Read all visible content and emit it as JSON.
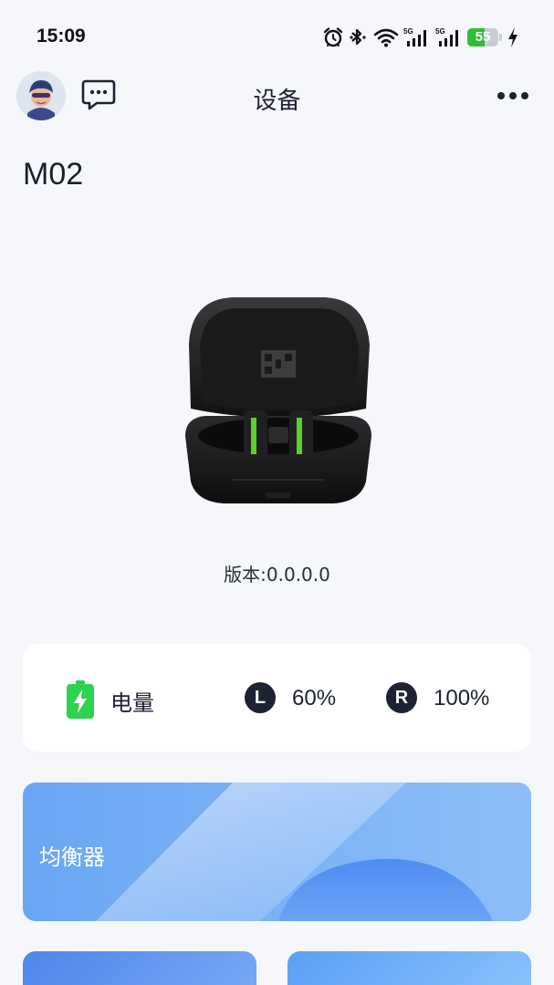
{
  "status_bar": {
    "time": "15:09",
    "icons": [
      "alarm-icon",
      "bluetooth-icon",
      "wifi-icon",
      "signal-5g-icon",
      "signal-5g-icon",
      "battery-icon",
      "charging-icon"
    ],
    "network_1": "5G",
    "network_2": "5G",
    "battery_percent": "55",
    "battery_color": "#2fbd3a"
  },
  "header": {
    "title": "设备"
  },
  "device": {
    "name": "M02",
    "version_text": "版本:0.0.0.0"
  },
  "battery_card": {
    "label": "电量",
    "left_badge": "L",
    "left_value": "60%",
    "right_badge": "R",
    "right_value": "100%",
    "icon_color": "#2ed24f"
  },
  "equalizer": {
    "label": "均衡器"
  }
}
